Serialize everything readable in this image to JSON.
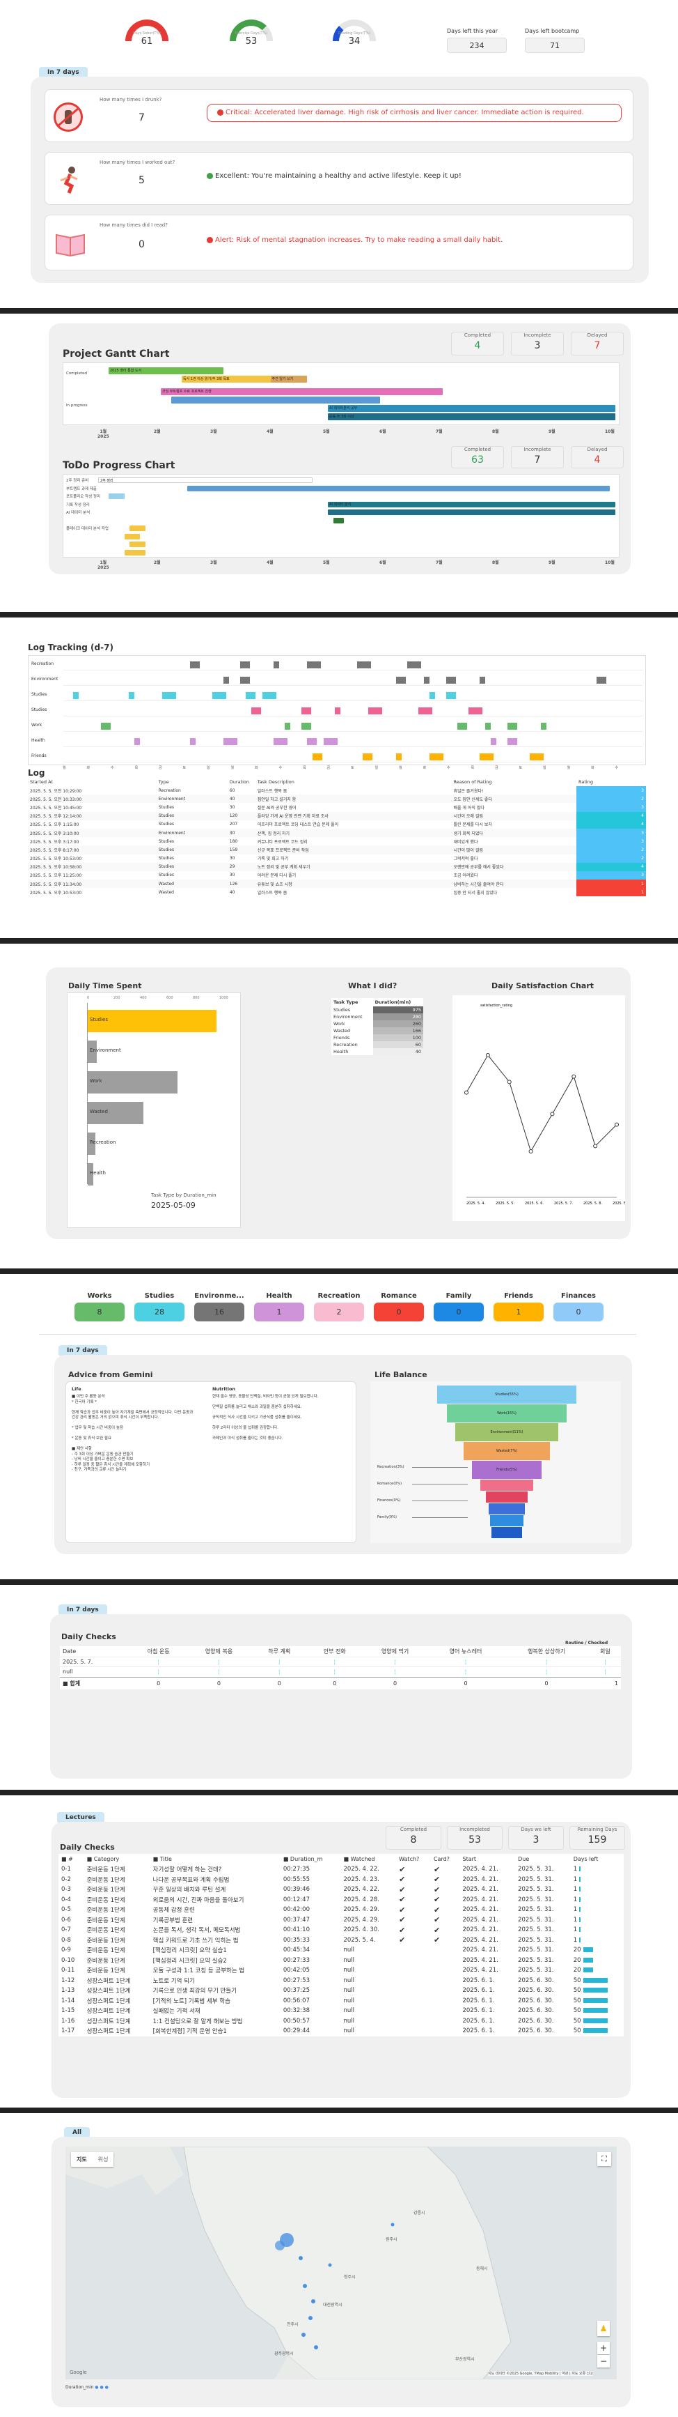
{
  "top": {
    "gauges": [
      {
        "label": "Days Sober(T%)",
        "value": "61",
        "color": "#e53935",
        "pct": 0.61
      },
      {
        "label": "Exercise Days(T%)",
        "value": "53",
        "color": "#43a047",
        "pct": 0.53
      },
      {
        "label": "Reading Days(T%)",
        "value": "34",
        "color": "#1e4fd1",
        "pct": 0.34
      }
    ],
    "days_left_label": "Days left this year",
    "days_left": "234",
    "bootcamp_label": "Days left bootcamp",
    "bootcamp": "71"
  },
  "seven_days": {
    "pill": "In 7 days",
    "items": [
      {
        "icon": "no-alcohol-icon",
        "question": "How many times I drunk?",
        "value": "7",
        "dot_color": "#e53935",
        "message": "Critical: Accelerated liver damage. High risk of cirrhosis and liver cancer. Immediate action is required.",
        "style": "alert"
      },
      {
        "icon": "running-icon",
        "question": "How many times I worked out?",
        "value": "5",
        "dot_color": "#43a047",
        "message": "Excellent: You're maintaining a healthy and active lifestyle. Keep it up!",
        "style": "ok"
      },
      {
        "icon": "book-icon",
        "question": "How many times did I read?",
        "value": "0",
        "dot_color": "#e53935",
        "message": "Alert: Risk of mental stagnation increases. Try to make reading a small daily habit.",
        "style": "warn"
      }
    ]
  },
  "gantt": {
    "title": "Project Gantt Chart",
    "stats": [
      {
        "label": "Completed",
        "value": "4",
        "color": "#2e9e57"
      },
      {
        "label": "Incomplete",
        "value": "3",
        "color": "#333"
      },
      {
        "label": "Delayed",
        "value": "7",
        "color": "#e53935"
      }
    ],
    "rows": [
      "Completed",
      "In progress"
    ],
    "bars": [
      {
        "row": 0,
        "lane": 0,
        "start": 0.02,
        "end": 0.24,
        "color": "#6dbf4b",
        "text": "2025 영어 통합 도서"
      },
      {
        "row": 0,
        "lane": 1,
        "start": 0.16,
        "end": 0.4,
        "color": "#f4c542",
        "text": "독서 1권 이상 읽기/주 3회 목표 "
      },
      {
        "row": 0,
        "lane": 1,
        "start": 0.33,
        "end": 0.4,
        "color": "#d9a35a",
        "text": "주간 일기 쓰기"
      },
      {
        "row": 1,
        "lane": 0,
        "start": 0.12,
        "end": 0.66,
        "color": "#e46fb8",
        "text": "코딩 부트캠프 수료 프로젝트 진행"
      },
      {
        "row": 1,
        "lane": 1,
        "start": 0.14,
        "end": 0.54,
        "color": "#5b9bd5",
        "text": ""
      },
      {
        "row": 1,
        "lane": 2,
        "start": 0.44,
        "end": 0.99,
        "color": "#2a8fbd",
        "text": "AI 데이터분석 공부"
      },
      {
        "row": 1,
        "lane": 3,
        "start": 0.44,
        "end": 0.99,
        "color": "#1f6f8b",
        "text": "운동 주 3회 이상"
      }
    ],
    "ticks": [
      "1월\n2025",
      "2월",
      "3월",
      "4월",
      "5월",
      "6월",
      "7월",
      "8월",
      "9월",
      "10월"
    ]
  },
  "todo": {
    "title": "ToDo Progress Chart",
    "stats": [
      {
        "label": "Completed",
        "value": "63",
        "color": "#2e9e57"
      },
      {
        "label": "Incomplete",
        "value": "7",
        "color": "#333"
      },
      {
        "label": "Delayed",
        "value": "4",
        "color": "#e53935"
      }
    ],
    "labels": [
      "2주 정리 준비",
      "부트캠프 과제 제출",
      "포트폴리오 작성 정리",
      "기록 작성 정리",
      "AI 데이터 분석",
      "",
      "플레이크 데이터 분석 작업",
      "",
      "",
      ""
    ],
    "bars": [
      {
        "y": 0,
        "start": 0.0,
        "end": 0.41,
        "color": "#ffffff",
        "text": "2주 정리"
      },
      {
        "y": 1,
        "start": 0.17,
        "end": 0.98,
        "color": "#5b9bd5",
        "text": ""
      },
      {
        "y": 2,
        "start": 0.02,
        "end": 0.05,
        "color": "#9ad0ea",
        "text": ""
      },
      {
        "y": 3,
        "start": 0.44,
        "end": 0.99,
        "color": "#1f7a8c",
        "text": "AI 데이터 분석"
      },
      {
        "y": 4,
        "start": 0.44,
        "end": 0.99,
        "color": "#1f6f8b",
        "text": ""
      },
      {
        "y": 5,
        "start": 0.45,
        "end": 0.47,
        "color": "#2e7d32",
        "text": ""
      },
      {
        "y": 6,
        "start": 0.06,
        "end": 0.09,
        "color": "#f4c542",
        "text": ""
      },
      {
        "y": 7,
        "start": 0.05,
        "end": 0.08,
        "color": "#f4c542",
        "text": ""
      },
      {
        "y": 8,
        "start": 0.06,
        "end": 0.09,
        "color": "#f4c542",
        "text": ""
      },
      {
        "y": 9,
        "start": 0.05,
        "end": 0.09,
        "color": "#f4c542",
        "text": ""
      }
    ],
    "ticks": [
      "1월\n2025",
      "2월",
      "3월",
      "4월",
      "5월",
      "6월",
      "7월",
      "8월",
      "9월",
      "10월"
    ]
  },
  "log_tracking": {
    "title": "Log Tracking (d-7)",
    "rows": [
      "Recreation",
      "Environment",
      "Studies",
      "Studies",
      "Work",
      "Health",
      "Friends"
    ],
    "axis": [
      "월",
      "화",
      "수",
      "목",
      "금",
      "토",
      "일"
    ]
  },
  "log": {
    "title": "Log",
    "headers": [
      "Started At",
      "Type",
      "Duration",
      "Task Description",
      "Reason of Rating",
      "Rating"
    ],
    "rows": [
      [
        "2025. 5. 5. 오전 10:29:00",
        "Recreation",
        "60",
        "일러스트 행복 봄",
        "휴일은 즐거웠다!",
        "3"
      ],
      [
        "2025. 5. 5. 오전 10:33:00",
        "Environment",
        "40",
        "집안일 하고 설거지 함",
        "오도 집안 신세도 좋다",
        "2"
      ],
      [
        "2025. 5. 5. 오전 10:45:00",
        "Studies",
        "30",
        "질문 AI와 공부한 영어",
        "배울 게 아직 많다",
        "3"
      ],
      [
        "2025. 5. 5. 오후 12:14:00",
        "Studies",
        "120",
        "플라잉 가게 AI 운영 관련 기획 자료 조사",
        "시간이 오래 걸림",
        "4"
      ],
      [
        "2025. 5. 5. 오후 1:15:00",
        "Studies",
        "207",
        "어프리미 프로젝트 코딩 테스트 연습 문제 풀이",
        "틀린 문제를 다시 보자",
        "4"
      ],
      [
        "2025. 5. 5. 오후 3:10:00",
        "Environment",
        "30",
        "산책, 집 정리 하기",
        "생기 회복 되었다",
        "3"
      ],
      [
        "2025. 5. 5. 오후 3:17:00",
        "Studies",
        "180",
        "커뮤니티 프로젝트 코드 정리",
        "재미있게 했다",
        "3"
      ],
      [
        "2025. 5. 5. 오후 8:17:00",
        "Studies",
        "159",
        "신규 목표 프로젝트 준비 작업",
        "시간이 많이 걸림",
        "2"
      ],
      [
        "2025. 5. 5. 오후 10:53:00",
        "Studies",
        "30",
        "기록 및 회고 하기",
        "그럭저럭 좋다",
        "2"
      ],
      [
        "2025. 5. 5. 오후 10:58:00",
        "Studies",
        "29",
        "노트 정리 및 공부 계획 세우기",
        "오랜만에 공부를 해서 좋았다",
        "4"
      ],
      [
        "2025. 5. 5. 오후 11:25:00",
        "Studies",
        "30",
        "어려운 문제 다시 풀기",
        "조금 어려웠다",
        "3"
      ],
      [
        "2025. 5. 5. 오후 11:34:00",
        "Wasted",
        "126",
        "유튜브 및 쇼츠 시청",
        "낭비하는 시간을 줄여야 한다",
        "1"
      ],
      [
        "2025. 5. 5. 오후 10:53:00",
        "Wasted",
        "40",
        "일러스트 행복 봄",
        "집중 안 되서 좋지 않았다",
        "1"
      ]
    ]
  },
  "daily": {
    "time_title": "Daily Time Spent",
    "time_bars": [
      {
        "label": "Studies",
        "value": 975,
        "color": "#ffc107"
      },
      {
        "label": "Environment",
        "value": 70,
        "color": "#9e9e9e"
      },
      {
        "label": "Work",
        "value": 680,
        "color": "#9e9e9e"
      },
      {
        "label": "Wasted",
        "value": 420,
        "color": "#9e9e9e"
      },
      {
        "label": "Recreation",
        "value": 60,
        "color": "#9e9e9e"
      },
      {
        "label": "Health",
        "value": 40,
        "color": "#9e9e9e"
      }
    ],
    "time_axis": [
      "0",
      "200",
      "400",
      "600",
      "800",
      "1000"
    ],
    "time_note_label": "Task Type by Duration_min",
    "time_note_date": "2025-05-09",
    "did_title": "What I did?",
    "did_headers": [
      "Task Type",
      "Duration(min)"
    ],
    "did_rows": [
      [
        "Studies",
        "975"
      ],
      [
        "Environment",
        "280"
      ],
      [
        "Work",
        "260"
      ],
      [
        "Wasted",
        "166"
      ],
      [
        "Friends",
        "100"
      ],
      [
        "Recreation",
        "60"
      ],
      [
        "Health",
        "40"
      ]
    ],
    "sat_title": "Daily Satisfaction Chart",
    "sat_legend": "satisfaction_rating",
    "sat_points": [
      3.2,
      3.9,
      3.4,
      2.1,
      2.8,
      3.5,
      2.2,
      2.6
    ],
    "sat_ticks": [
      "2025. 5. 4.",
      "2025. 5. 5.",
      "2025. 5. 6.",
      "2025. 5. 7.",
      "2025. 5. 8.",
      "2025. 5."
    ]
  },
  "categories": [
    {
      "name": "Works",
      "value": "8",
      "color": "#66bb6a"
    },
    {
      "name": "Studies",
      "value": "28",
      "color": "#4dd0e1"
    },
    {
      "name": "Environme...",
      "value": "16",
      "color": "#757575"
    },
    {
      "name": "Health",
      "value": "1",
      "color": "#ce93d8"
    },
    {
      "name": "Recreation",
      "value": "2",
      "color": "#f8bbd0"
    },
    {
      "name": "Romance",
      "value": "0",
      "color": "#f44336"
    },
    {
      "name": "Family",
      "value": "0",
      "color": "#1e88e5"
    },
    {
      "name": "Friends",
      "value": "1",
      "color": "#ffb300"
    },
    {
      "name": "Finances",
      "value": "0",
      "color": "#90caf9"
    }
  ],
  "advice": {
    "pill": "In 7 days",
    "title": "Advice from Gemini",
    "life_heading": "Life",
    "life_text": "■ 이번 주 활동 분석\n* 한국어 기록 *\n\n현재 학습과 업무 비중이 높아 자기계발 측면에서 긍정적입니다. 다만 운동과 건강 관리 활동은 거의 없으며 휴식 시간이 부족합니다.\n\n* 업무 및 학습 시간 비중이 높음\n\n* 운동 및 휴식 보완 필요\n\n■ 제안 사항\n- 주 3회 이상 가벼운 운동 습관 만들기\n- 낭비 시간을 줄이고 충분한 수면 확보\n- 하루 일정 중 짧은 휴식 시간을 계획에 포함하기\n- 친구, 가족과의 교류 시간 늘리기",
    "nutrition_heading": "Nutrition",
    "nutrition_text": "현재 필수 영양, 동물성 단백질, 비타민 등이 균형 있게 필요합니다.\n\n단백질 섭취를 늘리고 채소와 과일을 충분히 섭취하세요.\n\n규칙적인 식사 시간을 지키고 가공식품 섭취를 줄이세요.\n\n하루 2리터 이상의 물 섭취를 권장합니다.\n\n카페인과 야식 섭취를 줄이는 것이 좋습니다.",
    "balance_title": "Life Balance",
    "funnel": [
      {
        "label": "Studies(55%)",
        "color": "#7ecbf0",
        "w": 1.0
      },
      {
        "label": "Work(15%)",
        "color": "#6fd09a",
        "w": 0.86
      },
      {
        "label": "Environment(11%)",
        "color": "#9ec36a",
        "w": 0.74
      },
      {
        "label": "Wasted(7%)",
        "color": "#f0a35a",
        "w": 0.62
      },
      {
        "label": "Friends(5%)",
        "color": "#ab6fd0",
        "w": 0.5
      },
      {
        "label": "",
        "color": "#ef6f8a",
        "w": 0.38
      },
      {
        "label": "",
        "color": "#e0445e",
        "w": 0.3
      },
      {
        "label": "",
        "color": "#3c6fd8",
        "w": 0.26
      },
      {
        "label": "",
        "color": "#2f8de0",
        "w": 0.24
      },
      {
        "label": "",
        "color": "#1e5cc8",
        "w": 0.22
      }
    ],
    "funnel_side": [
      "Recreation(3%)",
      "Romance(0%)",
      "Finances(0%)",
      "Family(0%)"
    ]
  },
  "daily_checks": {
    "pill": "In 7 days",
    "title": "Daily Checks",
    "headers": [
      "Date",
      "아침 운동",
      "영양제 복용",
      "하루 계획",
      "안부 전화",
      "영양제 먹기",
      "영어 뉴스레터",
      "행복한 상상하기",
      "회일"
    ],
    "side_label": "Routine / Checked",
    "rows": [
      [
        "2025. 5. 7.",
        "",
        "",
        "",
        "",
        "",
        "",
        "",
        ""
      ],
      [
        "null",
        "",
        "",
        "",
        "",
        "",
        "",
        "",
        ""
      ]
    ],
    "total_label": "■ 합계",
    "totals": [
      "0",
      "0",
      "0",
      "0",
      "0",
      "0",
      "0",
      "1"
    ]
  },
  "lectures": {
    "pill": "Lectures",
    "title": "Daily Checks",
    "stats": [
      {
        "label": "Completed",
        "value": "8"
      },
      {
        "label": "Incompleted",
        "value": "53"
      },
      {
        "label": "Days we left",
        "value": "3"
      },
      {
        "label": "Remaining Days",
        "value": "159"
      }
    ],
    "headers": [
      "■ #",
      "■ Category",
      "■ Title",
      "■ Duration_m",
      "■ Watched",
      "Watch?",
      "Card?",
      "Start",
      "Due",
      "Days left"
    ],
    "rows": [
      [
        "0-1",
        "준비운동 1단계",
        "자기성찰 어떻게 하는 건데?",
        "00:27:35",
        "2025. 4. 22.",
        "✔",
        "✔",
        "2025. 4. 21.",
        "2025. 5. 31.",
        "1"
      ],
      [
        "0-2",
        "준비운동 1단계",
        "나다운 공부목표와 계획 수립법",
        "00:55:55",
        "2025. 4. 23.",
        "✔",
        "✔",
        "2025. 4. 21.",
        "2025. 5. 31.",
        "1"
      ],
      [
        "0-3",
        "준비운동 1단계",
        "꾸준 일상의 배치와 루틴 설계",
        "00:39:46",
        "2025. 4. 22.",
        "✔",
        "✔",
        "2025. 4. 21.",
        "2025. 5. 31.",
        "1"
      ],
      [
        "0-4",
        "준비운동 1단계",
        "외로움의 시간, 진짜 마음을 돌아보기",
        "00:12:47",
        "2025. 4. 28.",
        "✔",
        "✔",
        "2025. 4. 21.",
        "2025. 5. 31.",
        "1"
      ],
      [
        "0-5",
        "준비운동 1단계",
        "공동체 감정 훈련",
        "00:42:00",
        "2025. 4. 29.",
        "✔",
        "✔",
        "2025. 4. 21.",
        "2025. 5. 31.",
        "1"
      ],
      [
        "0-6",
        "준비운동 1단계",
        "기록공부법 훈련",
        "00:37:47",
        "2025. 4. 29.",
        "✔",
        "✔",
        "2025. 4. 21.",
        "2025. 5. 31.",
        "1"
      ],
      [
        "0-7",
        "준비운동 1단계",
        "논문을 독서, 생각 독서, 메모독서법",
        "00:41:10",
        "2025. 4. 30.",
        "✔",
        "✔",
        "2025. 4. 21.",
        "2025. 5. 31.",
        "1"
      ],
      [
        "0-8",
        "준비운동 1단계",
        "핵심 키워드로 기초 쓰기 익히는 법",
        "00:35:33",
        "2025. 5. 4.",
        "✔",
        "✔",
        "2025. 4. 21.",
        "2025. 5. 31.",
        "1"
      ],
      [
        "0-9",
        "준비운동 1단계",
        "[핵심정리 시크릿] 요약 실습1",
        "00:45:34",
        "null",
        "",
        "",
        "2025. 4. 21.",
        "2025. 5. 31.",
        "20"
      ],
      [
        "0-10",
        "준비운동 1단계",
        "[핵심정리 시크릿] 요약 실습2",
        "00:27:33",
        "null",
        "",
        "",
        "2025. 4. 21.",
        "2025. 5. 31.",
        "20"
      ],
      [
        "0-11",
        "준비운동 1단계",
        "모듈 구성과 1:1 코칭 등 공부하는 법",
        "00:42:05",
        "null",
        "",
        "",
        "2025. 4. 21.",
        "2025. 5. 31.",
        "20"
      ],
      [
        "1-12",
        "성장스퍼트 1단계",
        "노트로 기억 되기",
        "00:27:53",
        "null",
        "",
        "",
        "2025. 6. 1.",
        "2025. 6. 30.",
        "50"
      ],
      [
        "1-13",
        "성장스퍼트 1단계",
        "기록으로 인생 최강의 무기 만들기",
        "00:37:25",
        "null",
        "",
        "",
        "2025. 6. 1.",
        "2025. 6. 30.",
        "50"
      ],
      [
        "1-14",
        "성장스퍼트 1단계",
        "[기적의 노트] 기록법 세부 학습",
        "00:56:07",
        "null",
        "",
        "",
        "2025. 6. 1.",
        "2025. 6. 30.",
        "50"
      ],
      [
        "1-15",
        "성장스퍼트 1단계",
        "실패없는 기적 서재",
        "00:32:38",
        "null",
        "",
        "",
        "2025. 6. 1.",
        "2025. 6. 30.",
        "50"
      ],
      [
        "1-16",
        "성장스퍼트 1단계",
        "1:1 컨설팅으로 잘 알게 해보는 방법",
        "00:50:57",
        "null",
        "",
        "",
        "2025. 6. 1.",
        "2025. 6. 30.",
        "50"
      ],
      [
        "1-17",
        "성장스퍼트 1단계",
        "[회복한계점] 기적 운영 안습1",
        "00:29:44",
        "null",
        "",
        "",
        "2025. 6. 1.",
        "2025. 6. 30.",
        "50"
      ]
    ]
  },
  "map": {
    "pill": "All",
    "tabs": [
      "지도",
      "위성"
    ],
    "city_labels": [
      "강릉시",
      "원주시",
      "청주시",
      "대전광역시",
      "전주시",
      "광주광역시",
      "부산광역시",
      "동해시"
    ],
    "legend": "Duration_min",
    "attribution": "지도 데이터 ©2025 Google, TMap Mobility   |   약관   |   지도 오류 신고"
  }
}
